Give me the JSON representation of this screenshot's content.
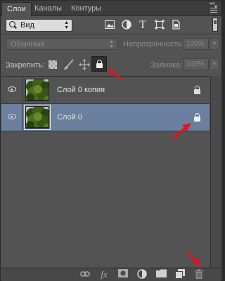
{
  "tabs": [
    {
      "label": "Слои",
      "active": true
    },
    {
      "label": "Каналы",
      "active": false
    },
    {
      "label": "Контуры",
      "active": false
    }
  ],
  "tab_close_glyph": "◂◂",
  "filter": {
    "kind_label": "Вид",
    "icons": [
      "image-filter-icon",
      "adjustment-filter-icon",
      "type-filter-icon",
      "shape-filter-icon",
      "smart-object-filter-icon"
    ]
  },
  "blend": {
    "mode": "Обычные",
    "opacity_label": "Непрозрачность:",
    "opacity_value": "100%",
    "fill_label": "Заливка:",
    "fill_value": "100%"
  },
  "lock": {
    "label": "Закрепить:",
    "all_active": true
  },
  "layers": [
    {
      "name": "Слой 0 копия",
      "visible": true,
      "locked": true,
      "selected": false
    },
    {
      "name": "Слой 0",
      "visible": true,
      "locked": true,
      "selected": true
    }
  ],
  "footer_icons": [
    "link-layers-icon",
    "fx-icon",
    "mask-icon",
    "adjustment-layer-icon",
    "group-folder-icon",
    "new-layer-icon",
    "trash-icon"
  ],
  "colors": {
    "panel_bg": "#535353",
    "selected_row": "#6b7f9e",
    "annotation_arrow": "#e0141e"
  }
}
